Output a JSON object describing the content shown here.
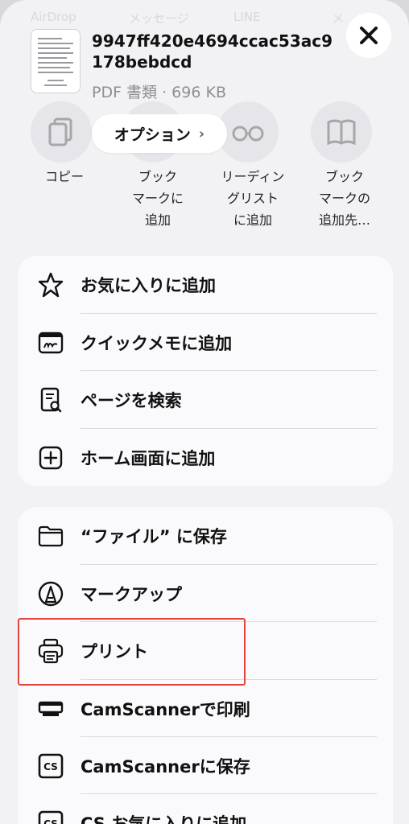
{
  "background_apps": [
    "AirDrop",
    "メッセージ",
    "LINE",
    "メ"
  ],
  "file": {
    "name": "9947ff420e4694ccac53ac9178bebdcd",
    "meta": "PDF 書類 · 696 KB"
  },
  "options_button": {
    "label": "オプション",
    "chevron": "›"
  },
  "actions_row": [
    {
      "label": "コピー",
      "icon": "copy-icon"
    },
    {
      "label": "ブック\nマークに\n追加",
      "icon": "bookmark-icon"
    },
    {
      "label": "リーディン\nグリスト\nに追加",
      "icon": "glasses-icon"
    },
    {
      "label": "ブック\nマークの\n追加先…",
      "icon": "book-icon"
    }
  ],
  "group1": [
    {
      "label": "お気に入りに追加",
      "icon": "star-icon"
    },
    {
      "label": "クイックメモに追加",
      "icon": "quick-note-icon"
    },
    {
      "label": "ページを検索",
      "icon": "find-on-page-icon"
    },
    {
      "label": "ホーム画面に追加",
      "icon": "add-square-icon"
    }
  ],
  "group2": [
    {
      "label": "“ファイル” に保存",
      "icon": "folder-icon"
    },
    {
      "label": "マークアップ",
      "icon": "markup-pen-icon"
    },
    {
      "label": "プリント",
      "icon": "printer-icon"
    },
    {
      "label": "CamScannerで印刷",
      "icon": "scanner-printer-icon"
    },
    {
      "label": "CamScannerに保存",
      "icon": "cs-icon"
    },
    {
      "label": "CS お気に入りに追加",
      "icon": "cs-icon"
    }
  ],
  "colors": {
    "highlight": "#e0463d",
    "sheet": "#f2f2f5",
    "group": "#fafafc"
  }
}
